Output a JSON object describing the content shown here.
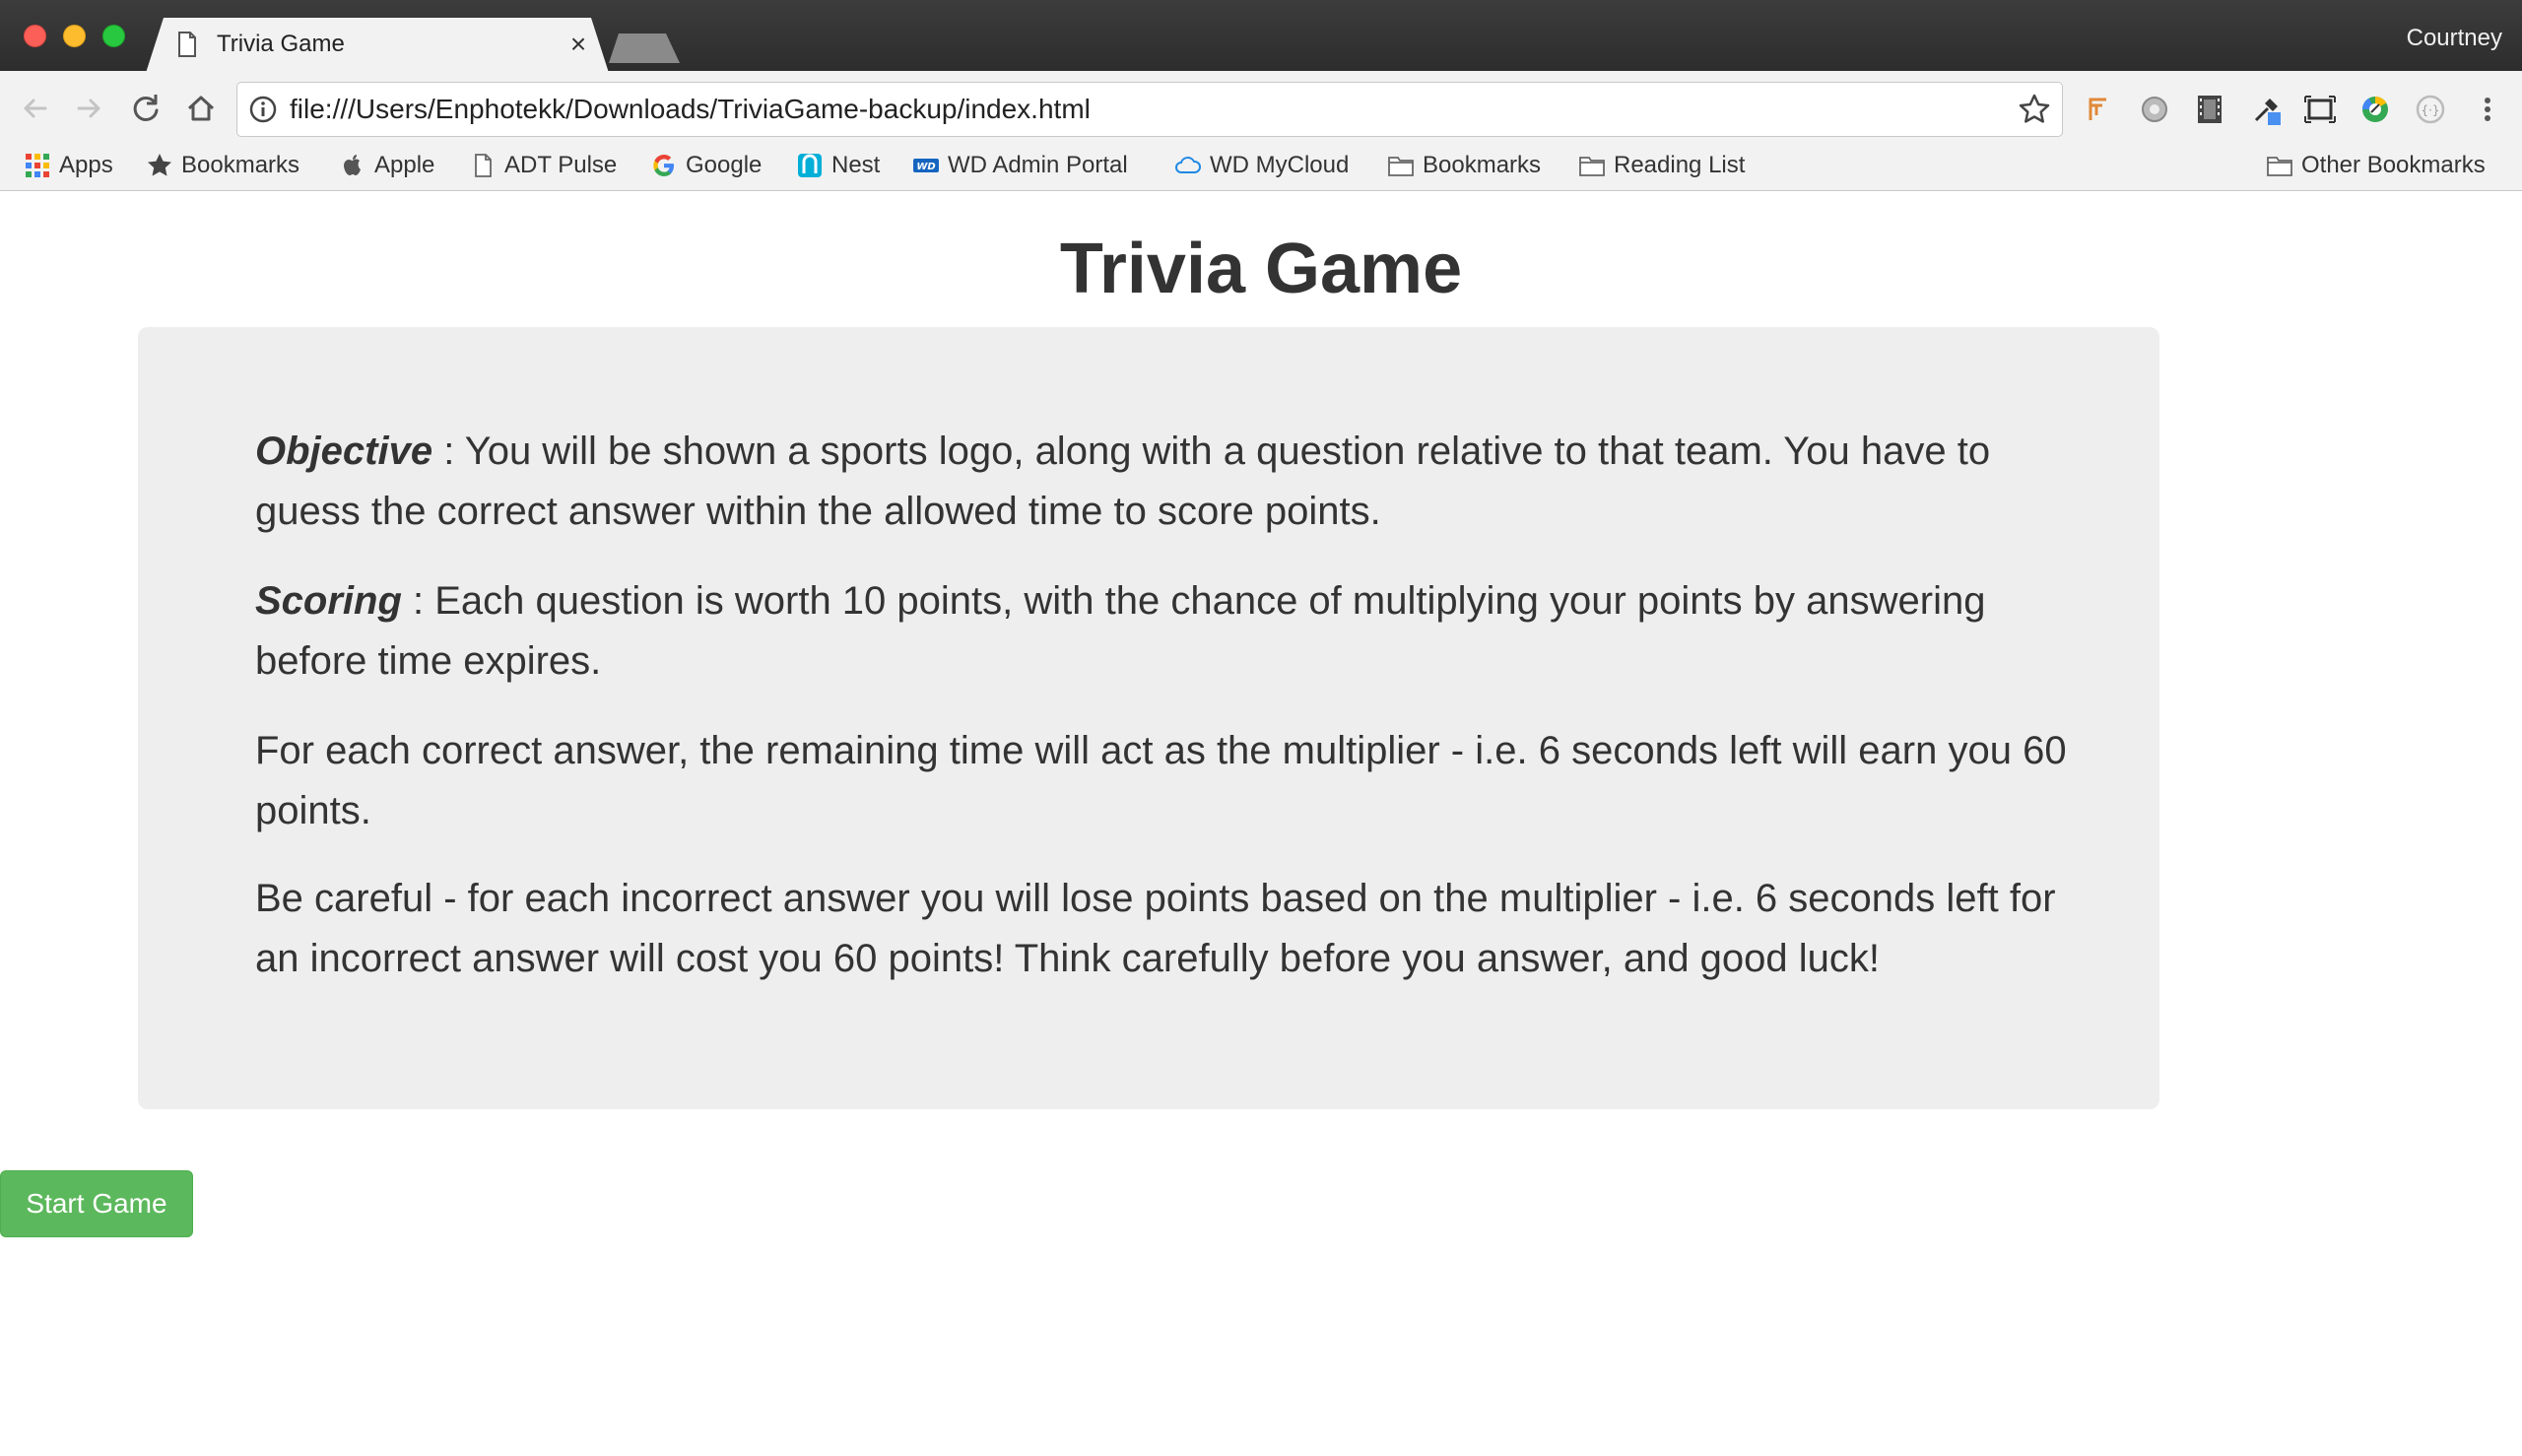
{
  "browser": {
    "tab_title": "Trivia Game",
    "tab_close": "×",
    "profile_name": "Courtney",
    "url": "file:///Users/Enphotekk/Downloads/TriviaGame-backup/index.html",
    "bookmarks": [
      {
        "label": "Apps",
        "icon": "apps-grid-icon"
      },
      {
        "label": "Bookmarks",
        "icon": "star-icon"
      },
      {
        "label": "Apple",
        "icon": "apple-icon"
      },
      {
        "label": "ADT Pulse",
        "icon": "page-icon"
      },
      {
        "label": "Google",
        "icon": "google-icon"
      },
      {
        "label": "Nest",
        "icon": "nest-icon"
      },
      {
        "label": "WD Admin Portal",
        "icon": "wd-icon"
      },
      {
        "label": "WD MyCloud",
        "icon": "cloud-icon"
      },
      {
        "label": "Bookmarks",
        "icon": "folder-icon"
      },
      {
        "label": "Reading List",
        "icon": "folder-icon"
      }
    ],
    "other_bookmarks": "Other Bookmarks"
  },
  "page": {
    "title": "Trivia Game",
    "objective_label": "Objective",
    "objective_text": " : You will be shown a sports logo, along with a question relative to that team. You have to guess the correct answer within the allowed time to score points.",
    "scoring_label": "Scoring",
    "scoring_text": " : Each question is worth 10 points, with the chance of multiplying your points by answering before time expires.",
    "multiplier_text": "For each correct answer, the remaining time will act as the multiplier - i.e. 6 seconds left will earn you 60 points.",
    "careful_text": "Be careful - for each incorrect answer you will lose points based on the multiplier - i.e. 6 seconds left for an incorrect answer will cost you 60 points! Think carefully before you answer, and good luck!",
    "start_button": "Start Game"
  },
  "colors": {
    "start_button": "#5cb85c",
    "panel_bg": "#eeeeee",
    "text": "#333333"
  }
}
